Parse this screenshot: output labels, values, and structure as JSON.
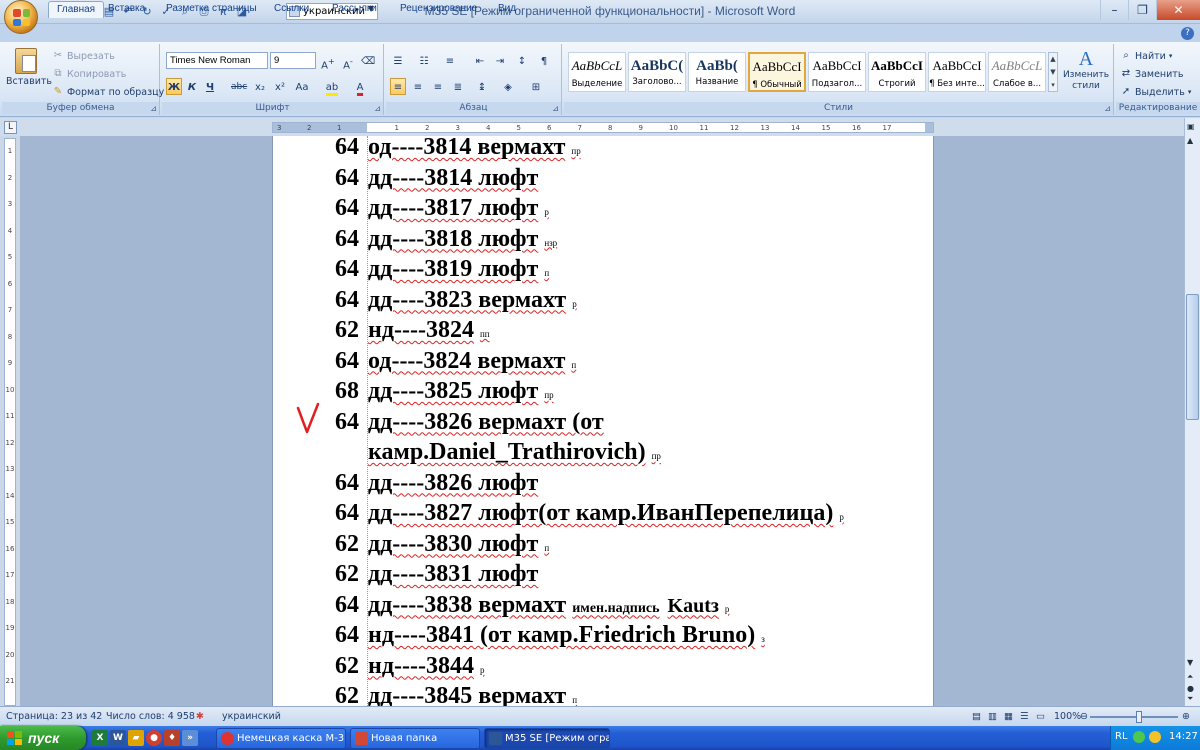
{
  "window": {
    "title": "M35 SE [Режим ограниченной функциональности] - Microsoft Word",
    "language": "украинский"
  },
  "tabs": [
    "Главная",
    "Вставка",
    "Разметка страницы",
    "Ссылки",
    "Рассылки",
    "Рецензирование",
    "Вид"
  ],
  "clipboard": {
    "paste": "Вставить",
    "cut": "Вырезать",
    "copy": "Копировать",
    "format_painter": "Формат по образцу",
    "group": "Буфер обмена"
  },
  "font": {
    "name": "Times New Roman",
    "size": "9",
    "group": "Шрифт",
    "bold": "Ж",
    "italic": "К",
    "underline": "Ч",
    "strike": "abc",
    "sub": "x₂",
    "sup": "x²",
    "case": "Aa"
  },
  "paragraph": {
    "group": "Абзац"
  },
  "styles": {
    "group": "Стили",
    "items": [
      {
        "sample": "AaBbCcL",
        "name": "Выделение"
      },
      {
        "sample": "AaBbC(",
        "name": "Заголово..."
      },
      {
        "sample": "AaBb(",
        "name": "Название"
      },
      {
        "sample": "AaBbCcI",
        "name": "¶ Обычный"
      },
      {
        "sample": "AaBbCcI",
        "name": "Подзагол..."
      },
      {
        "sample": "AaBbCcI",
        "name": "Строгий"
      },
      {
        "sample": "AaBbCcI",
        "name": "¶ Без инте..."
      },
      {
        "sample": "AaBbCcL",
        "name": "Слабое в..."
      }
    ],
    "change": "Изменить стили"
  },
  "editing": {
    "group": "Редактирование",
    "find": "Найти",
    "replace": "Заменить",
    "select": "Выделить"
  },
  "ruler": {
    "h_numbers": [
      "3",
      "2",
      "1",
      "1",
      "2",
      "3",
      "4",
      "5",
      "6",
      "7",
      "8",
      "9",
      "10",
      "11",
      "12",
      "13",
      "14",
      "15",
      "16",
      "17"
    ],
    "v_numbers": [
      "1",
      "2",
      "3",
      "4",
      "5",
      "6",
      "7",
      "8",
      "9",
      "10",
      "11",
      "12",
      "13",
      "14",
      "15",
      "16",
      "17",
      "18",
      "19",
      "20",
      "21"
    ]
  },
  "document": {
    "lines": [
      {
        "num": "64",
        "text": "од----3814 вермахт",
        "tag": "пр"
      },
      {
        "num": "64",
        "text": "дд----3814 люфт",
        "tag": ""
      },
      {
        "num": "64",
        "text": "дд----3817 люфт",
        "tag": "р"
      },
      {
        "num": "64",
        "text": "дд----3818 люфт",
        "tag": "нзр"
      },
      {
        "num": "64",
        "text": "дд----3819 люфт",
        "tag": "п"
      },
      {
        "num": "64",
        "text": "дд----3823 вермахт",
        "tag": "р"
      },
      {
        "num": "62",
        "text": "нд----3824",
        "tag": "пп"
      },
      {
        "num": "64",
        "text": "од----3824 вермахт",
        "tag": "п"
      },
      {
        "num": "68",
        "text": "дд----3825 люфт",
        "tag": "пр"
      },
      {
        "num": "64",
        "text": "дд----3826 вермахт (от",
        "tag": ""
      },
      {
        "num": "",
        "text": "камр.Daniel_Trathirovich)",
        "tag": "пр"
      },
      {
        "num": "64",
        "text": "дд----3826 люфт",
        "tag": ""
      },
      {
        "num": "64",
        "text": "дд----3827 люфт(от  камр.ИванПерепелица)",
        "tag": "р"
      },
      {
        "num": "62",
        "text": "дд----3830 люфт",
        "tag": "п"
      },
      {
        "num": "62",
        "text": "дд----3831 люфт",
        "tag": ""
      },
      {
        "num": "64",
        "text": "дд----3838 вермахт",
        "note": "имен.надпись",
        "extra": "Kautз",
        "tag": "р"
      },
      {
        "num": "64",
        "text": "нд----3841 (от камр.Friedrich Bruno)",
        "tag": "з"
      },
      {
        "num": "62",
        "text": "нд----3844",
        "tag": "р"
      },
      {
        "num": "62",
        "text": "дд----3845 вермахт",
        "tag": "п"
      }
    ]
  },
  "status": {
    "page": "Страница: 23 из 42",
    "words": "Число слов: 4 958",
    "lang": "украинский",
    "zoom": "100%"
  },
  "taskbar": {
    "start": "пуск",
    "tasks": [
      {
        "label": "Немецкая каска М-3...",
        "color": "#e0332f"
      },
      {
        "label": "Новая папка",
        "color": "#d14836"
      },
      {
        "label": "M35 SE [Режим огра...",
        "color": "#2b5797"
      }
    ],
    "lang": "RL",
    "clock": "14:27"
  },
  "colors": {
    "accent": "#15428b",
    "spellcheck": "#dd2222",
    "checkmark": "#e02020"
  }
}
